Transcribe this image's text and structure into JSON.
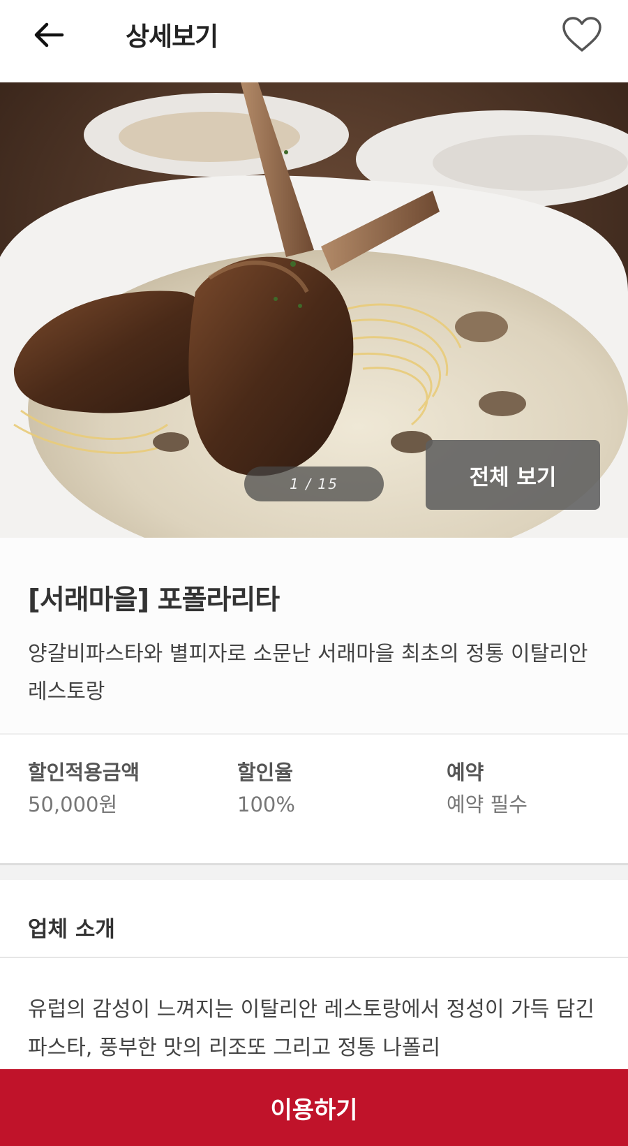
{
  "header": {
    "title": "상세보기",
    "back_icon": "arrow-left-icon",
    "favorite_icon": "heart-outline-icon"
  },
  "gallery": {
    "indicator": "1 / 15",
    "view_all_label": "전체 보기"
  },
  "place": {
    "name": "[서래마을] 포폴라리타",
    "description": "양갈비파스타와 별피자로 소문난 서래마을 최초의 정통 이탈리안 레스토랑"
  },
  "stats": [
    {
      "label": "할인적용금액",
      "value": "50,000원"
    },
    {
      "label": "할인율",
      "value": "100%"
    },
    {
      "label": "예약",
      "value": "예약 필수"
    }
  ],
  "intro": {
    "title": "업체 소개",
    "text": "유럽의 감성이 느껴지는 이탈리안 레스토랑에서 정성이 가득 담긴 파스타, 풍부한 맛의 리조또 그리고 정통 나폴리"
  },
  "cta": {
    "label": "이용하기",
    "color": "#c0132a"
  }
}
